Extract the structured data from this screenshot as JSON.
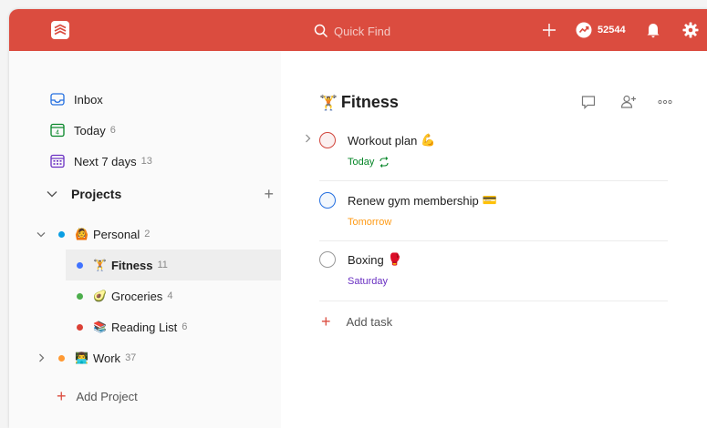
{
  "topbar": {
    "search_placeholder": "Quick Find",
    "karma_count": "52544",
    "accent": "#db4c3f"
  },
  "sidebar": {
    "nav": [
      {
        "label": "Inbox",
        "count": "",
        "icon": "inbox-icon"
      },
      {
        "label": "Today",
        "count": "6",
        "icon": "calendar-today-icon"
      },
      {
        "label": "Next 7 days",
        "count": "13",
        "icon": "calendar-week-icon"
      }
    ],
    "projects_header": "Projects",
    "projects": [
      {
        "name": "Personal",
        "count": "2",
        "color": "#0a9ee3",
        "emoji": "🙆"
      },
      {
        "name": "Fitness",
        "count": "11",
        "color": "#4073ff",
        "emoji": "🏋"
      },
      {
        "name": "Groceries",
        "count": "4",
        "color": "#4cae4c",
        "emoji": "🥑"
      },
      {
        "name": "Reading List",
        "count": "6",
        "color": "#db4035",
        "emoji": "📚"
      },
      {
        "name": "Work",
        "count": "37",
        "color": "#ff9933",
        "emoji": "👨‍💻"
      }
    ],
    "add_project": "Add Project"
  },
  "main": {
    "title": "Fitness",
    "title_emoji": "🏋",
    "tasks": [
      {
        "content": "Workout plan",
        "emoji": "💪",
        "due": "Today",
        "due_color": "#058527",
        "priority_color": "#d1453b",
        "recurring": true
      },
      {
        "content": "Renew gym membership",
        "emoji": "💳",
        "due": "Tomorrow",
        "due_color": "#ff9a14",
        "priority_color": "#246fe0",
        "recurring": false
      },
      {
        "content": "Boxing",
        "emoji": "🥊",
        "due": "Saturday",
        "due_color": "#692fc2",
        "priority_color": "#999999",
        "recurring": false
      }
    ],
    "add_task": "Add task"
  }
}
